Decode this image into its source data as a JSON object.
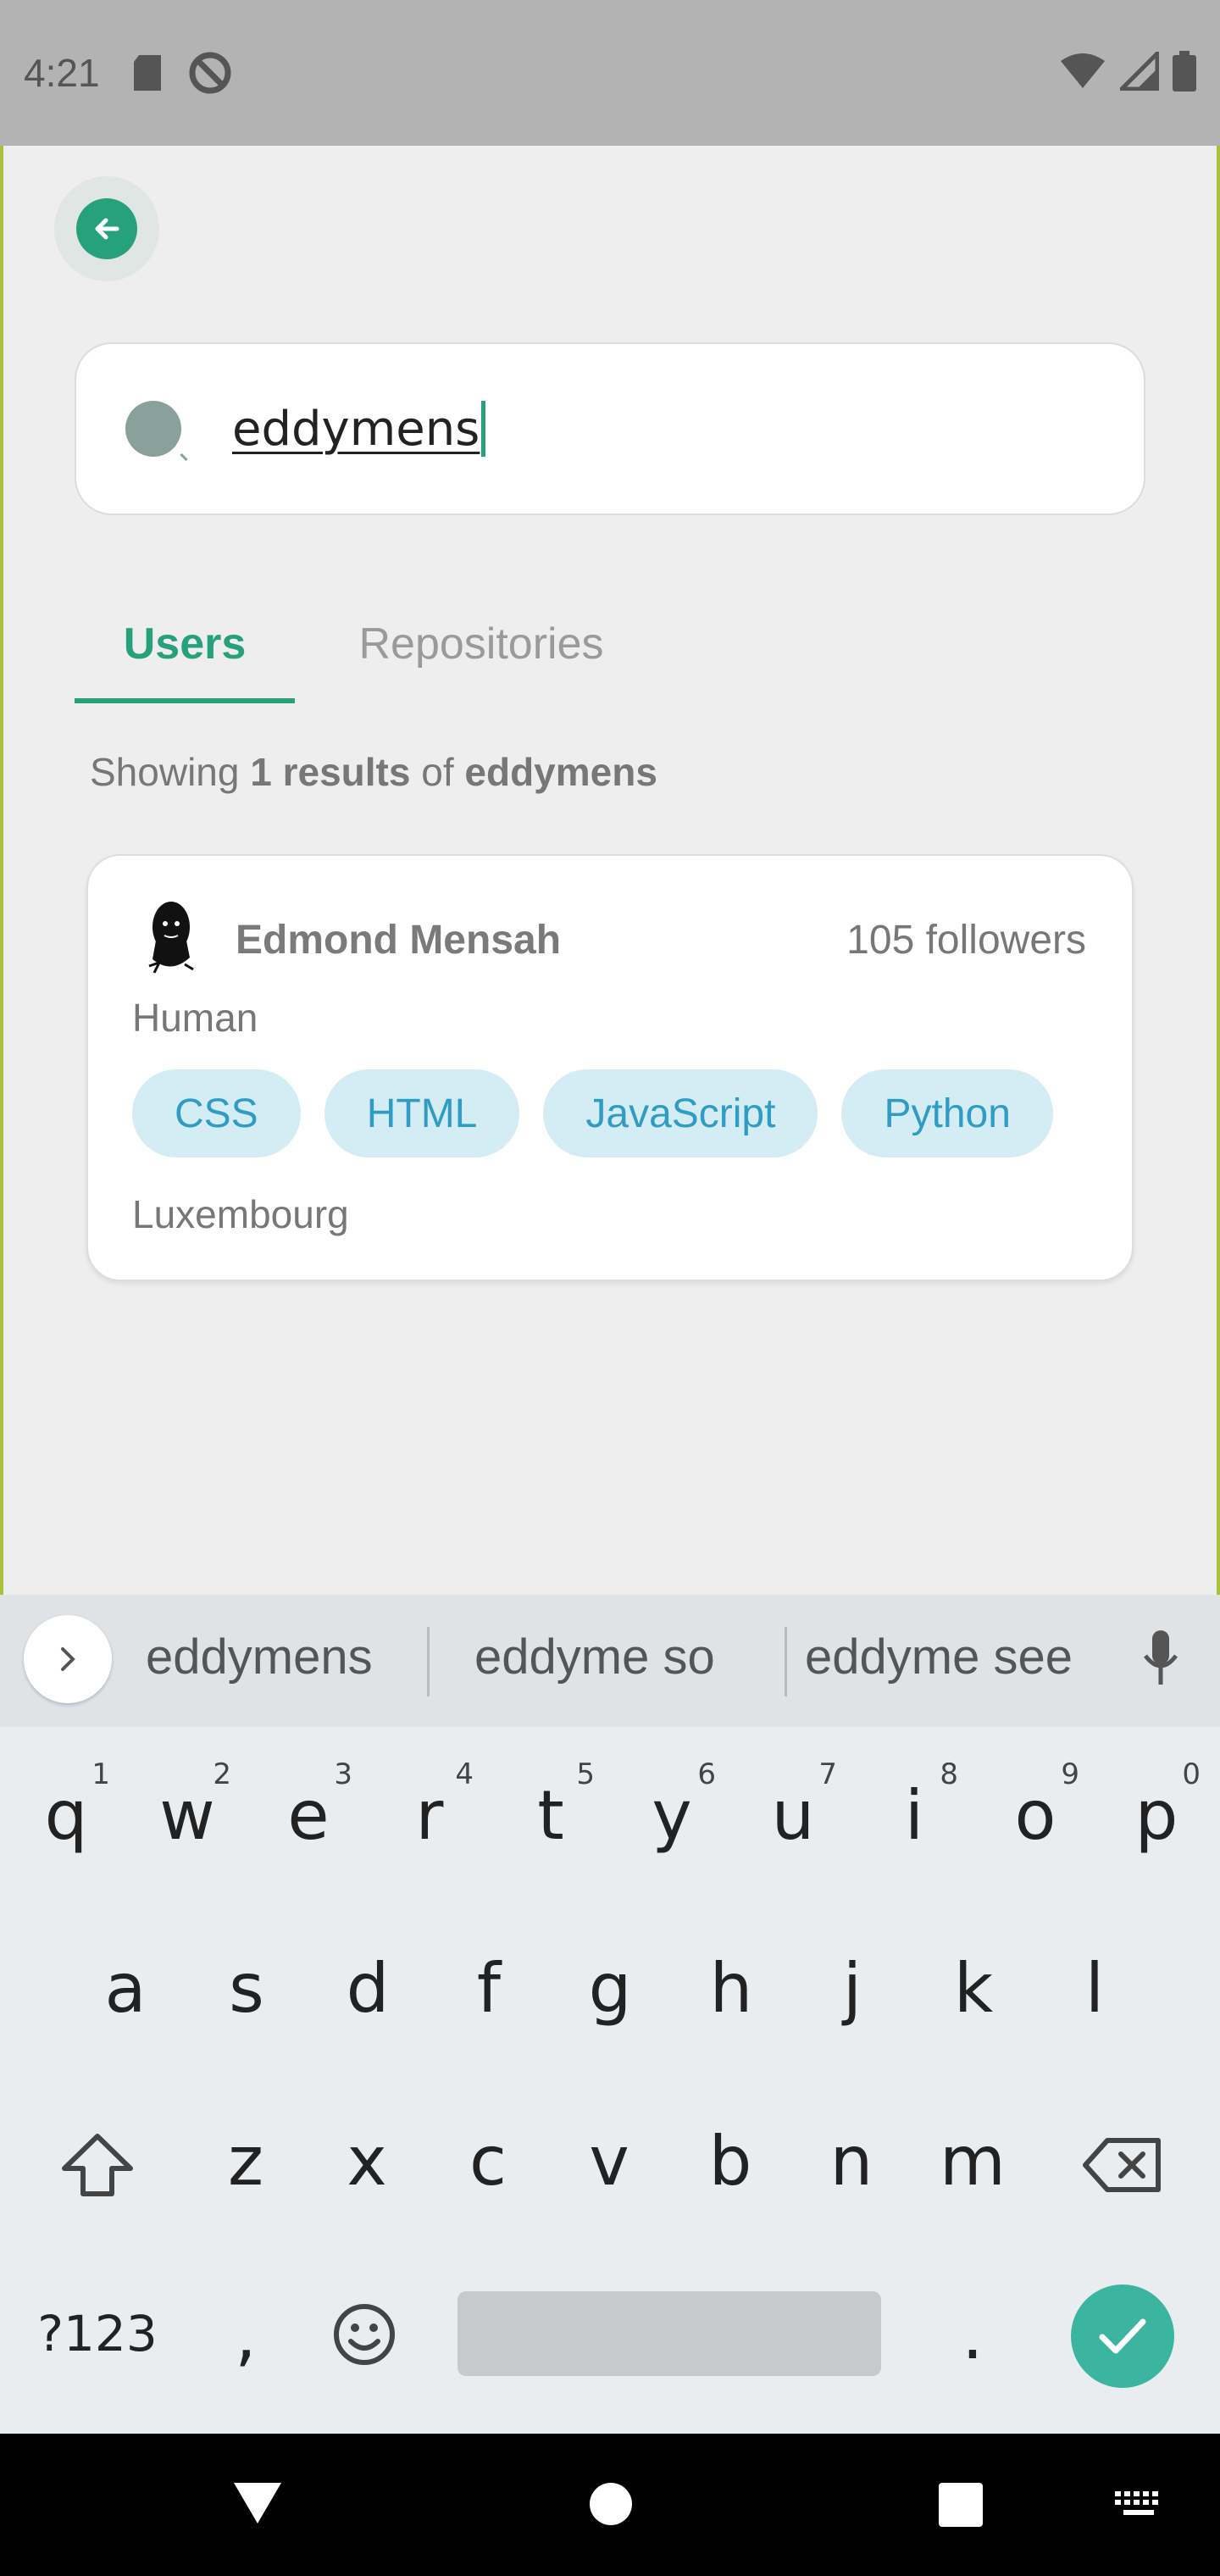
{
  "status_bar": {
    "time": "4:21"
  },
  "search": {
    "value": "eddymens"
  },
  "tabs": {
    "users": "Users",
    "repositories": "Repositories"
  },
  "results": {
    "prefix": "Showing ",
    "count": "1 results",
    "middle": " of ",
    "query": "eddymens"
  },
  "user": {
    "name": "Edmond Mensah",
    "followers": "105 followers",
    "bio": "Human",
    "tags": [
      "CSS",
      "HTML",
      "JavaScript",
      "Python"
    ],
    "location": "Luxembourg"
  },
  "keyboard": {
    "suggestions": [
      "eddymens",
      "eddyme so",
      "eddyme see"
    ],
    "row1": [
      {
        "k": "q",
        "h": "1"
      },
      {
        "k": "w",
        "h": "2"
      },
      {
        "k": "e",
        "h": "3"
      },
      {
        "k": "r",
        "h": "4"
      },
      {
        "k": "t",
        "h": "5"
      },
      {
        "k": "y",
        "h": "6"
      },
      {
        "k": "u",
        "h": "7"
      },
      {
        "k": "i",
        "h": "8"
      },
      {
        "k": "o",
        "h": "9"
      },
      {
        "k": "p",
        "h": "0"
      }
    ],
    "row2": [
      "a",
      "s",
      "d",
      "f",
      "g",
      "h",
      "j",
      "k",
      "l"
    ],
    "row3": [
      "z",
      "x",
      "c",
      "v",
      "b",
      "n",
      "m"
    ],
    "symbols_label": "?123",
    "comma": ",",
    "period": "."
  },
  "colors": {
    "accent": "#26a17b",
    "tag_bg": "#d4ecf3",
    "tag_text": "#2e9cc5",
    "enter_key": "#3bb5a0"
  }
}
